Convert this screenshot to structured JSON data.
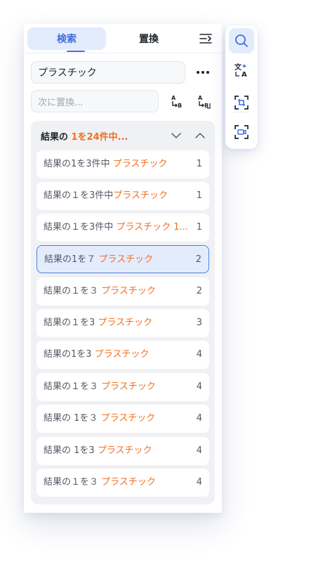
{
  "tabs": {
    "search": "検索",
    "replace": "置換"
  },
  "search": {
    "value": "プラスチック"
  },
  "replace": {
    "placeholder": "次に置換..."
  },
  "results_header": {
    "prefix": "結果の ",
    "count": "1を24件中..."
  },
  "icons": {
    "collapse": "collapse-panel-icon",
    "more": "more-icon",
    "replace_one": "replace-one-icon",
    "replace_all": "replace-all-icon",
    "prev": "chevron-down-icon",
    "next": "chevron-up-icon",
    "side": [
      "search-icon",
      "translate-icon",
      "crop-icon",
      "screen-record-icon"
    ]
  },
  "colors": {
    "accent": "#3e6fe0",
    "highlight": "#f26f1f",
    "active_bg": "#e3ecfd"
  },
  "results": [
    {
      "prefix": "結果の1を3件中 ",
      "hit": "プラスチック",
      "num": "1"
    },
    {
      "prefix": "結果の１を3件中",
      "hit": "プラスチック",
      "num": "1"
    },
    {
      "prefix": "結果の１を3件中 ",
      "hit": "プラスチック 1...",
      "num": "1"
    },
    {
      "prefix": "結果の1を７ ",
      "hit": "プラスチック",
      "num": "2"
    },
    {
      "prefix": "結果の１を３ ",
      "hit": "プラスチック",
      "num": "2"
    },
    {
      "prefix": "結果の１を3 ",
      "hit": "プラスチック",
      "num": "3"
    },
    {
      "prefix": "結果の1を3 ",
      "hit": "プラスチック",
      "num": "4"
    },
    {
      "prefix": "結果の１を３ ",
      "hit": "プラスチック",
      "num": "4"
    },
    {
      "prefix": "結果の 1を３ ",
      "hit": "プラスチック",
      "num": "4"
    },
    {
      "prefix": "結果の 1を3 ",
      "hit": "プラスチック",
      "num": "4"
    },
    {
      "prefix": "結果の１を３ ",
      "hit": "プラスチック",
      "num": "4"
    }
  ]
}
